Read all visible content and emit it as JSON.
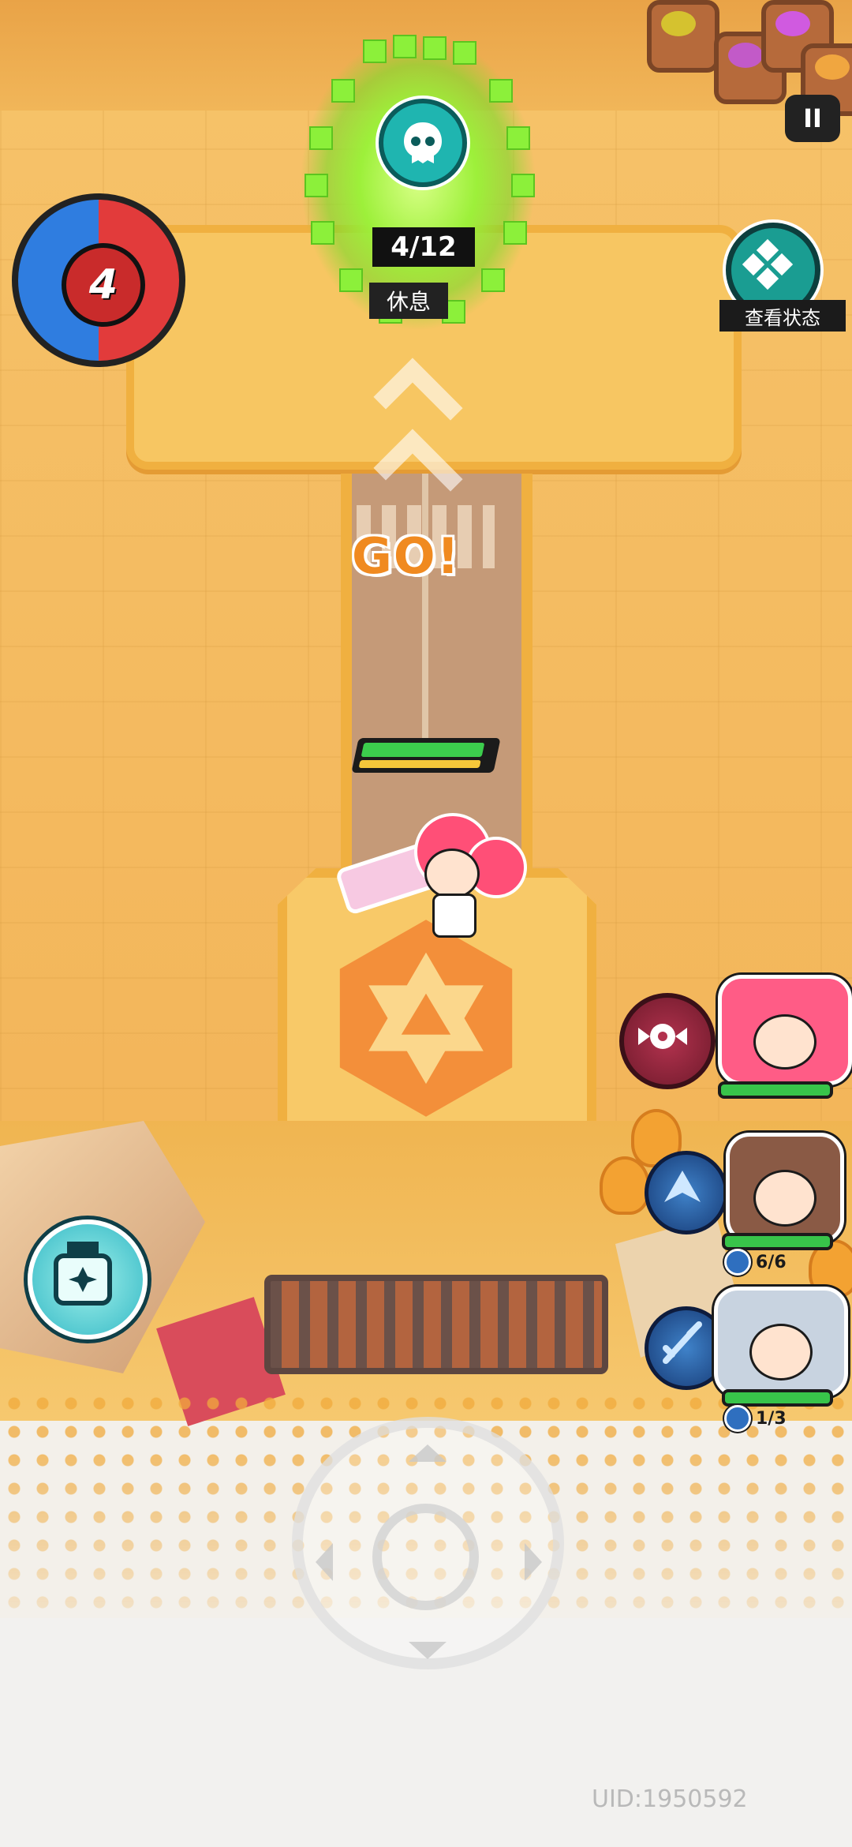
{
  "hud": {
    "wave_number": "4",
    "pause_label": "II",
    "status_button_label": "查看状态"
  },
  "portal": {
    "progress_text": "4/12",
    "progress_value": 4,
    "progress_max": 12,
    "state_label": "休息",
    "icon": "ghost-skull-icon"
  },
  "prompt": {
    "go_text": "GO!",
    "direction_icon": "chevron-up-icon"
  },
  "player": {
    "hp_fraction": 0.93,
    "energy_fraction": 0.93
  },
  "party": [
    {
      "name": "",
      "role": "active",
      "hp_fraction": 0.95,
      "skill_icon": "candy-skill-icon"
    },
    {
      "name": "",
      "role": "support",
      "hp_fraction": 0.95,
      "charges_text": "6/6",
      "skill_icon": "wing-skill-icon"
    },
    {
      "name": "",
      "role": "support",
      "hp_fraction": 0.95,
      "charges_text": "1/3",
      "skill_icon": "sword-skill-icon"
    }
  ],
  "item_button": {
    "icon": "robot-item-icon"
  },
  "footer": {
    "uid_text": "UID:1950592"
  },
  "colors": {
    "portal_green": "#8cf03a",
    "go_orange": "#f08a20",
    "wave_red": "#e23b3b",
    "wave_blue": "#2f7de0",
    "hp_green": "#38c44a",
    "accent_teal": "#1a9d92"
  }
}
